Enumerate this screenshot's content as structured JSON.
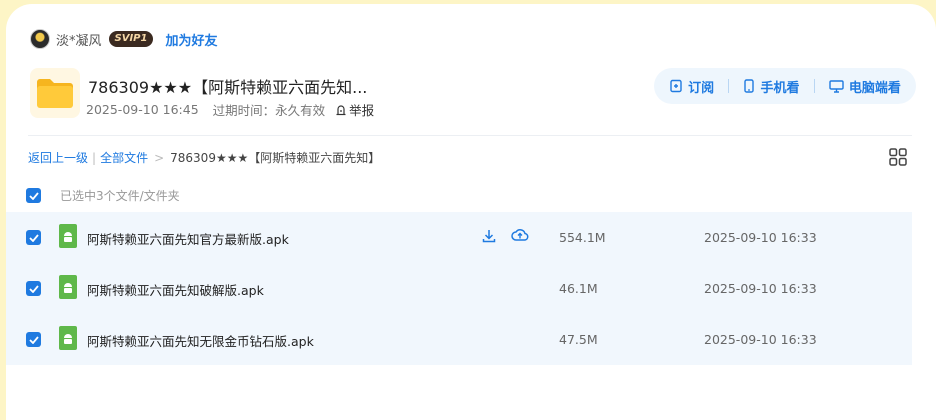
{
  "user": {
    "name": "淡*凝风",
    "badge": "SVIP1",
    "add_friend": "加为好友"
  },
  "share": {
    "title": "786309★★★【阿斯特赖亚六面先知...",
    "date": "2025-09-10 16:45",
    "expire_label": "过期时间：永久有效",
    "report": "举报"
  },
  "actions": {
    "subscribe": "订阅",
    "mobile": "手机看",
    "pc": "电脑端看"
  },
  "breadcrumb": {
    "back": "返回上一级",
    "all": "全部文件",
    "current": "786309★★★【阿斯特赖亚六面先知】"
  },
  "selection": {
    "text": "已选中3个文件/文件夹"
  },
  "files": [
    {
      "name": "阿斯特赖亚六面先知官方最新版.apk",
      "size": "554.1M",
      "date": "2025-09-10 16:33"
    },
    {
      "name": "阿斯特赖亚六面先知破解版.apk",
      "size": "46.1M",
      "date": "2025-09-10 16:33"
    },
    {
      "name": "阿斯特赖亚六面先知无限金币钻石版.apk",
      "size": "47.5M",
      "date": "2025-09-10 16:33"
    }
  ],
  "colors": {
    "accent": "#1f7ae0",
    "page_bg": "#fdf5c6",
    "row_bg": "#f1f7fd",
    "apk_green": "#5fb84a"
  }
}
